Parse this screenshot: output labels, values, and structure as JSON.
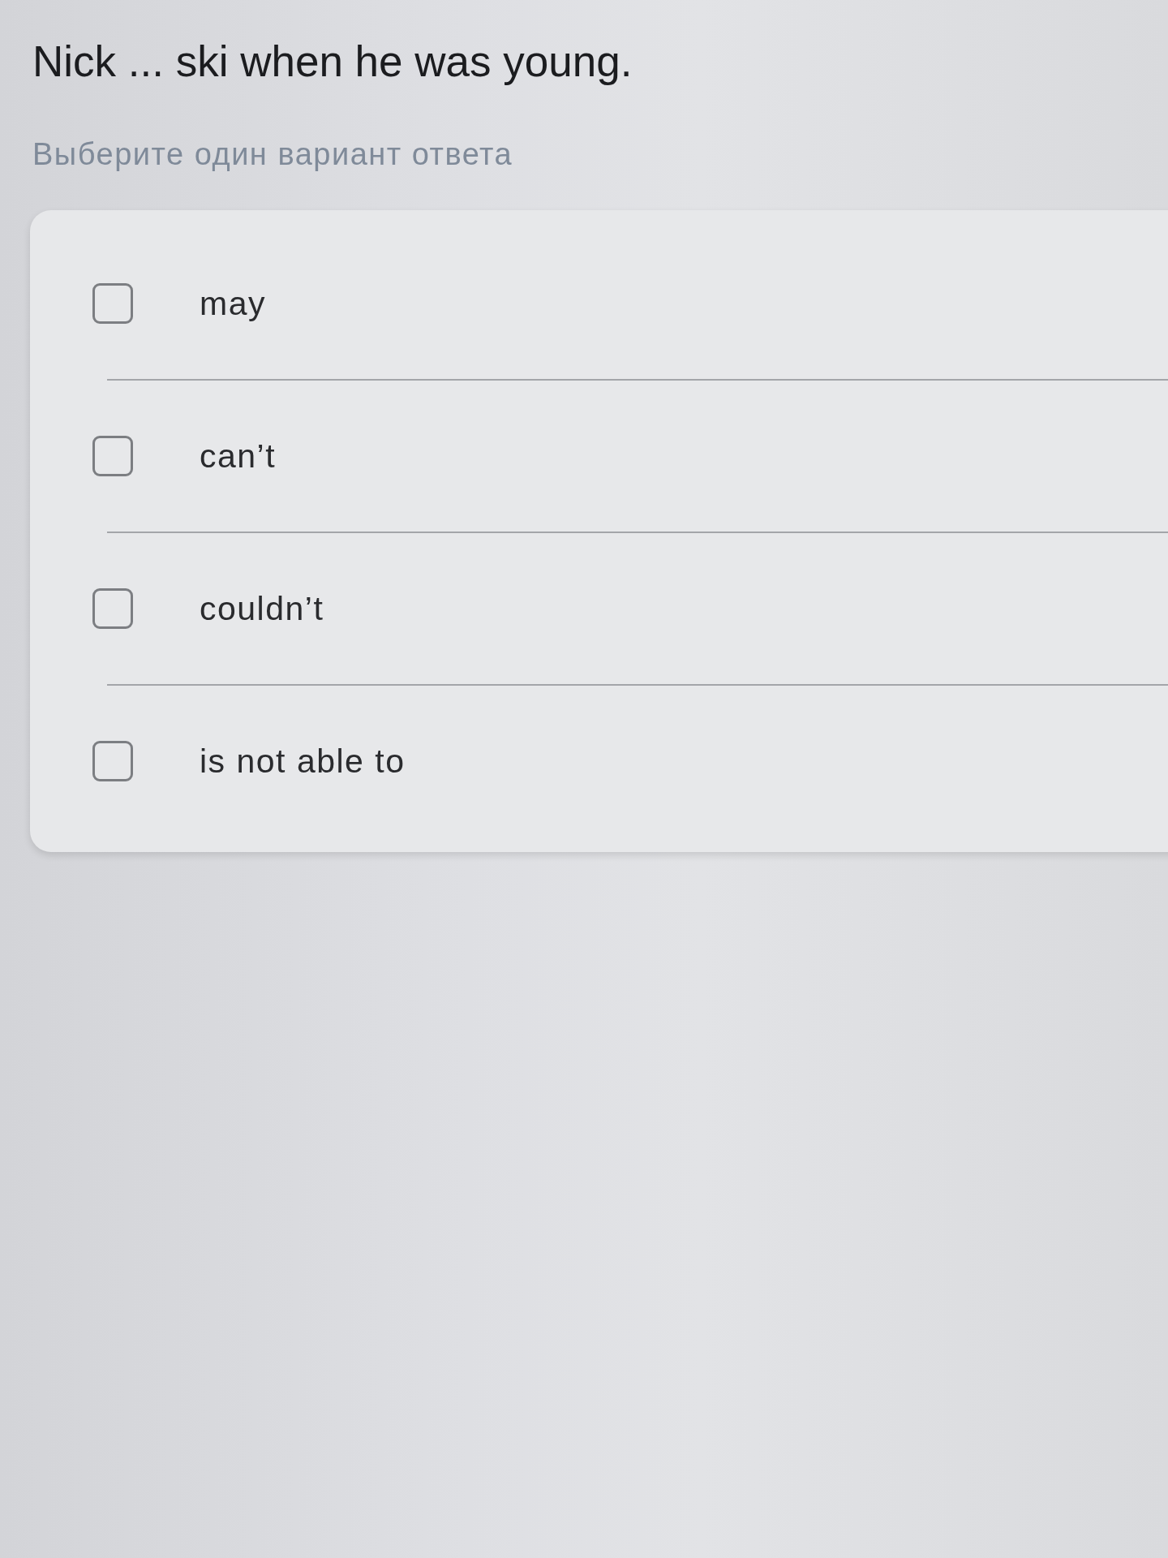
{
  "question": {
    "text": "Nick ... ski when he was young.",
    "instruction": "Выберите один вариант ответа"
  },
  "options": [
    {
      "label": "may",
      "checked": false
    },
    {
      "label": "can’t",
      "checked": false
    },
    {
      "label": "couldn’t",
      "checked": false
    },
    {
      "label": "is not able to",
      "checked": false
    }
  ]
}
